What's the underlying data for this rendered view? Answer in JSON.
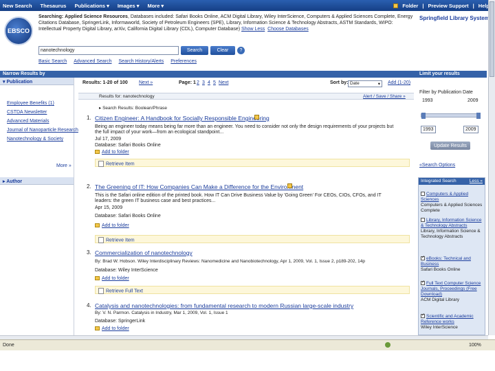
{
  "topnav": {
    "items": [
      "New Search",
      "Thesaurus",
      "Publications",
      "Images",
      "More"
    ],
    "folder": "Folder",
    "preview": "Preview Support",
    "help": "Help"
  },
  "logo": {
    "text": "EBSCO"
  },
  "library": "Springfield Library System",
  "searching": {
    "label": "Searching:",
    "collection": "Applied Science Resources",
    "databases": "Databases included: Safari Books Online, ACM Digital Library, Wiley InterScience, Computers & Applied Sciences Complete, Energy Citations Database, SpringerLink, Informaworld, Society of Petroleum Engineers (SPE), Library, Information Science & Technology Abstracts, ASTM Standards, WIPO: Intellectual Property Digital Library, arXiv, California Digital Library (CDL), Computer Database)",
    "show_less": "Show Less",
    "choose": "Choose Databases"
  },
  "search": {
    "query": "nanotechnology",
    "search_btn": "Search",
    "clear_btn": "Clear",
    "help": "?"
  },
  "sublinks": [
    "Basic Search",
    "Advanced Search",
    "Search History/Alerts",
    "Preferences"
  ],
  "bands": {
    "left": "Narrow Results by",
    "right": "Limit your results"
  },
  "left": {
    "publication_head": "Publication",
    "publications": [
      "Employee Benefits (1)",
      "CSTDA Newsletter",
      "Advanced Materials",
      "Journal of Nanoparticle Research",
      "Nanotechnology & Society"
    ],
    "more": "More »",
    "author_head": "Author"
  },
  "results": {
    "count": "Results: 1-20 of 100",
    "next": "Next »",
    "page_label": "Page: 1",
    "pages": [
      "2",
      "3",
      "4",
      "5"
    ],
    "page_next": "Next",
    "sort_label": "Sort by:",
    "sort_value": "Date",
    "add": "Add (1-20)",
    "results_for": "Results for: nanotechnology",
    "tools": "Alert / Save / Share »",
    "boolean": "Search Results: Boolean/Phrase"
  },
  "items": [
    {
      "num": "1.",
      "title": "Citizen Engineer: A Handbook for Socially Responsible Engineering",
      "abstract": "Being an engineer today means being far more than an engineer. You need to consider not only the design requirements of your projects but the full impact of your work—from an ecological standpoint...",
      "date": "Jul 17, 2009",
      "db": "Database: Safari Books Online",
      "folder": "Add to folder",
      "retrieve": "Retrieve Item"
    },
    {
      "num": "2.",
      "title": "The Greening of IT: How Companies Can Make a Difference for the Environment",
      "abstract": "This is the Safari online edition of the printed book. How IT Can Drive Business Value by 'Going Green' For CEOs, CIOs, CFOs, and IT leaders: the green IT business case and best practices...",
      "date": "Apr 15, 2009",
      "db": "Database: Safari Books Online",
      "folder": "Add to folder",
      "retrieve": "Retrieve Item"
    },
    {
      "num": "3.",
      "title": "Commercialization of nanotechnology",
      "byline": "By: Brad W. Hobson. Wiley Interdisciplinary Reviews: Nanomedicine and Nanobiotechnology, Apr 1, 2009, Vol. 1, Issue 2, p189-202, 14p",
      "db": "Database: Wiley InterScience",
      "folder": "Add to folder",
      "retrieve": "Retrieve Full Text"
    },
    {
      "num": "4.",
      "title": "Catalysis and nanotechnologies: from fundamental research to modern Russian large-scale industry",
      "byline": "By: V. N. Parmon. Catalysis in Industry, Mar 1, 2009, Vol. 1, Issue 1",
      "db": "Database: SpringerLink",
      "folder": "Add to folder"
    }
  ],
  "right": {
    "filter_label": "Filter by Publication Date",
    "from_year": "1993",
    "to_year": "2009",
    "from_value": "1993",
    "to_value": "2009",
    "update": "Update Results",
    "search_options": "«Search Options",
    "integrated_head": "Integrated Search",
    "integrated_less": "Less «",
    "dbs": [
      {
        "name": "Computers & Applied Sciences",
        "sub": "Computers & Applied Sciences Complete",
        "checked": false
      },
      {
        "name": "Library, Information Science & Technology Abstracts",
        "sub": "Library, Information Science & Technology Abstracts",
        "checked": false
      },
      {
        "name": "eBooks: Technical and Business",
        "sub": "Safari Books Online",
        "checked": true
      },
      {
        "name": "Full Text Computer Science Journals, Proceedings (Free Download)",
        "sub": "ACM Digital Library",
        "checked": true
      },
      {
        "name": "Scientific and Academic Reference works",
        "sub": "Wiley InterScience",
        "checked": true
      }
    ]
  },
  "status": {
    "left": "Done",
    "right": "100%"
  }
}
